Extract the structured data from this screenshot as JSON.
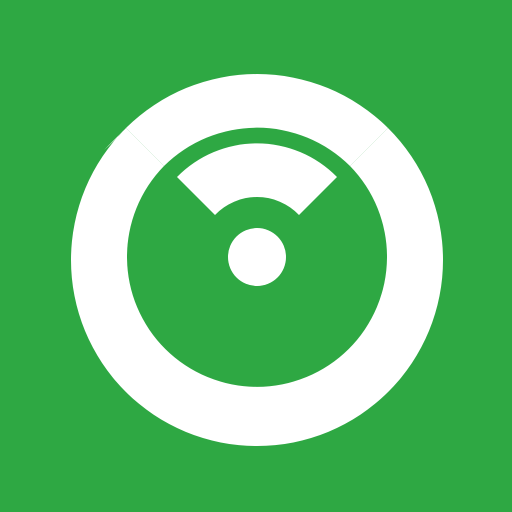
{
  "icon": {
    "name": "wifi-ring-icon",
    "background_color": "#2ea843",
    "foreground_color": "#ffffff"
  }
}
